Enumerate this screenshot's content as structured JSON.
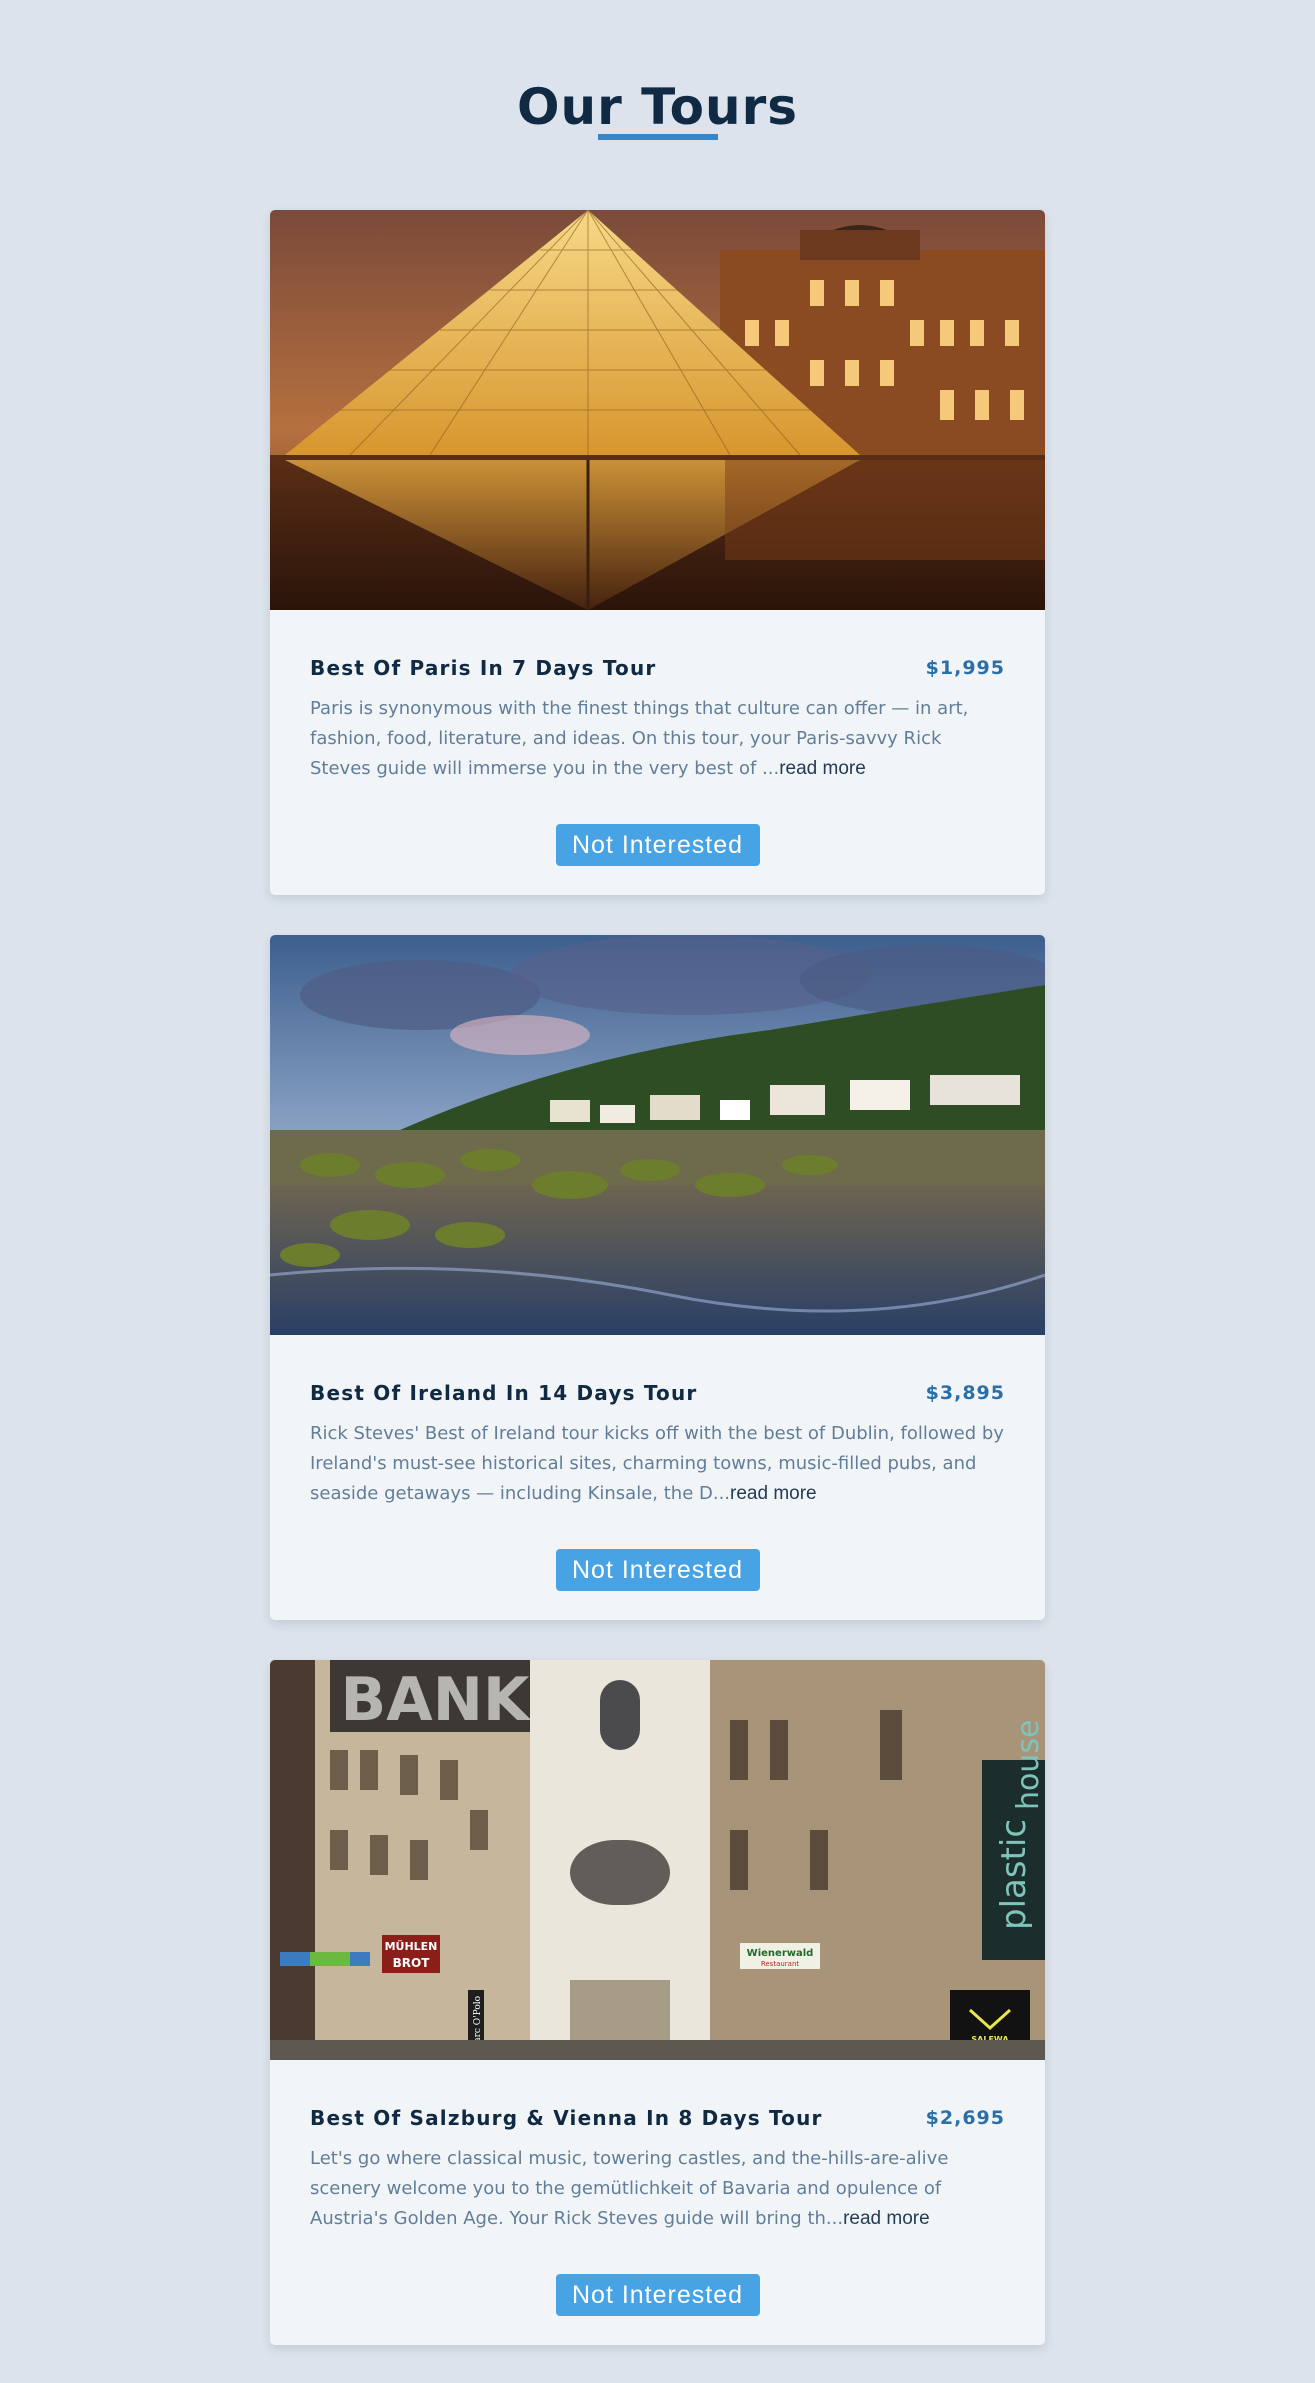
{
  "page": {
    "title": "Our Tours"
  },
  "colors": {
    "background": "#dde3ec",
    "accent": "#3585c8",
    "button": "#48a3e4",
    "price": "#2a6fa8",
    "heading": "#102a43"
  },
  "tours": [
    {
      "name": "Best Of Paris In 7 Days Tour",
      "price": "$1,995",
      "description": "Paris is synonymous with the finest things that culture can offer — in art, fashion, food, literature, and ideas. On this tour, your Paris-savvy Rick Steves guide will immerse you in the very best of ...",
      "read_more": "read more",
      "button": "Not Interested",
      "image_icon": "louvre-pyramid-photo"
    },
    {
      "name": "Best Of Ireland In 14 Days Tour",
      "price": "$3,895",
      "description": "Rick Steves' Best of Ireland tour kicks off with the best of Dublin, followed by Ireland's must-see historical sites, charming towns, music-filled pubs, and seaside getaways — including Kinsale, the D...",
      "read_more": "read more",
      "button": "Not Interested",
      "image_icon": "irish-coast-photo"
    },
    {
      "name": "Best Of Salzburg & Vienna In 8 Days Tour",
      "price": "$2,695",
      "description": "Let's go where classical music, towering castles, and the-hills-are-alive scenery welcome you to the gemütlichkeit of Bavaria and opulence of Austria's Golden Age. Your Rick Steves guide will bring th...",
      "read_more": "read more",
      "button": "Not Interested",
      "image_icon": "vienna-street-photo",
      "signs": {
        "bank": "BANK",
        "plastic": "plastic",
        "house": "house",
        "muhlen": "MÜHLEN",
        "brot": "BROT",
        "wienerwald": "Wienerwald",
        "restaurant": "Restaurant",
        "salewa": "SALEWA",
        "marc": "Marc O'Polo"
      }
    }
  ]
}
